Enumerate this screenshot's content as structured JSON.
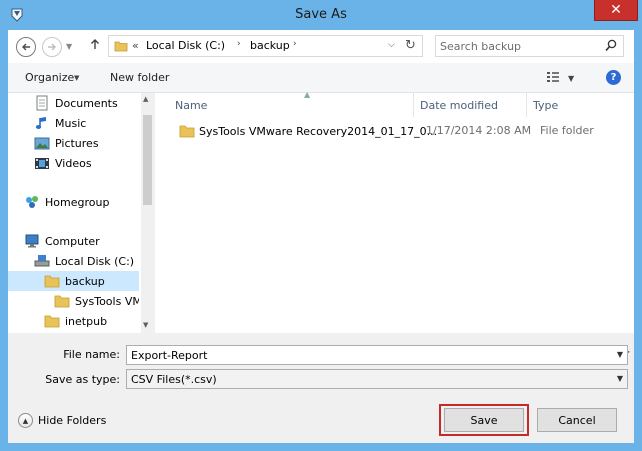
{
  "window": {
    "title": "Save As",
    "close_glyph": "✕",
    "colors": {
      "frame": "#6ab3e8",
      "close": "#c7302b",
      "selection": "#cce8ff",
      "highlight": "#c42b2b"
    }
  },
  "address_bar": {
    "overflow": "«",
    "crumbs": [
      "Local Disk (C:)",
      "backup"
    ],
    "icons": [
      "back-arrow-icon",
      "forward-arrow-icon",
      "up-arrow-icon",
      "folder-icon",
      "refresh-icon"
    ]
  },
  "search": {
    "placeholder": "Search backup",
    "icon": "search-icon"
  },
  "toolbar": {
    "organize": "Organize",
    "new_folder": "New folder",
    "help": "?"
  },
  "nav_pane": {
    "items": [
      {
        "label": "Documents",
        "icon": "documents-icon"
      },
      {
        "label": "Music",
        "icon": "music-icon"
      },
      {
        "label": "Pictures",
        "icon": "pictures-icon"
      },
      {
        "label": "Videos",
        "icon": "videos-icon"
      },
      {
        "label": "Homegroup",
        "icon": "homegroup-icon"
      },
      {
        "label": "Computer",
        "icon": "computer-icon"
      },
      {
        "label": "Local Disk (C:)",
        "icon": "drive-icon"
      },
      {
        "label": "backup",
        "icon": "folder-icon",
        "selected": true
      },
      {
        "label": "SysTools VMw",
        "icon": "folder-icon"
      },
      {
        "label": "inetpub",
        "icon": "folder-icon"
      }
    ]
  },
  "file_list": {
    "columns": [
      "Name",
      "Date modified",
      "Type"
    ],
    "rows": [
      {
        "name": "SysTools VMware Recovery2014_01_17_0...",
        "date": "1/17/2014 2:08 AM",
        "type": "File folder"
      }
    ]
  },
  "form": {
    "file_name_label": "File name:",
    "file_name_value": "Export-Report",
    "save_type_label": "Save as type:",
    "save_type_value": "CSV Files(*.csv)"
  },
  "footer": {
    "hide_folders": "Hide Folders",
    "save": "Save",
    "cancel": "Cancel"
  }
}
